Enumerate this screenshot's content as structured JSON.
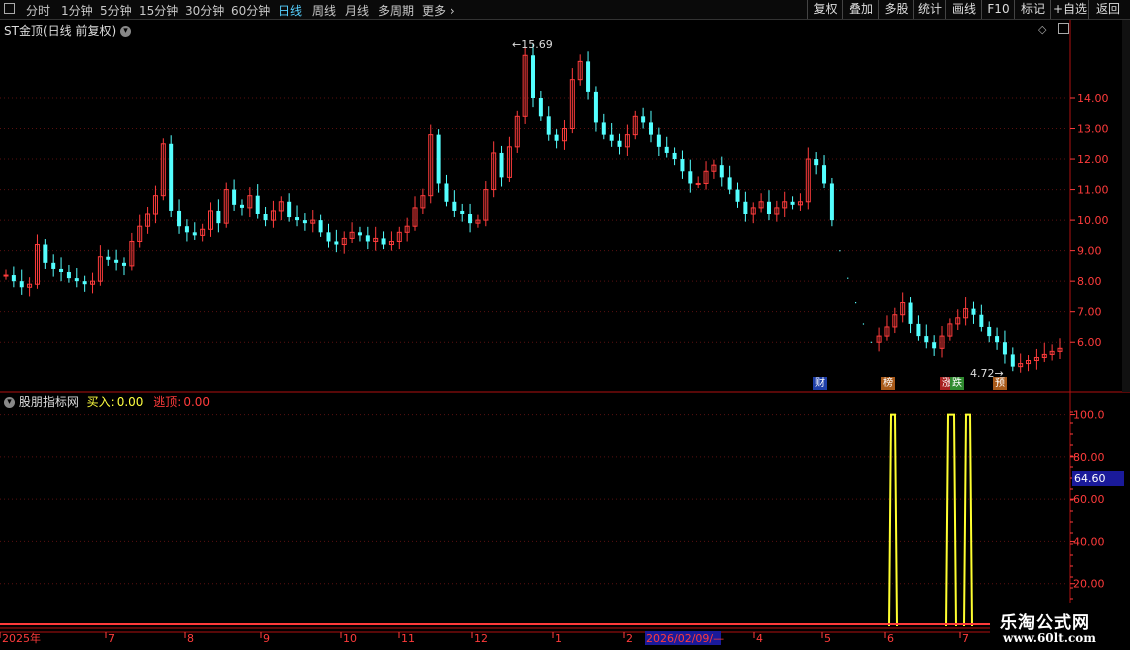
{
  "toolbar": {
    "periods": [
      "分时",
      "1分钟",
      "5分钟",
      "15分钟",
      "30分钟",
      "60分钟",
      "日线",
      "周线",
      "月线",
      "多周期",
      "更多"
    ],
    "active_period": "日线",
    "right_buttons": [
      "复权",
      "叠加",
      "多股",
      "统计",
      "画线",
      "F10",
      "标记",
      "+自选",
      "返回"
    ]
  },
  "main_panel": {
    "title": "ST金顶(日线 前复权)",
    "high_label": "15.69",
    "low_label": "4.72",
    "badges": [
      "财",
      "榜",
      "涨",
      "跌",
      "预"
    ]
  },
  "indicator_panel": {
    "name": "股朋指标网",
    "buy_label": "买入:",
    "buy_value": "0.00",
    "sell_label": "逃顶:",
    "sell_value": "0.00",
    "current_value": "64.60"
  },
  "axes": {
    "price_ticks": [
      "14.00",
      "13.00",
      "12.00",
      "11.00",
      "10.00",
      "9.00",
      "8.00",
      "7.00",
      "6.00"
    ],
    "indicator_ticks": [
      "100.0",
      "80.00",
      "60.00",
      "40.00",
      "20.00"
    ],
    "x_labels": [
      "2025年",
      "7",
      "8",
      "9",
      "10",
      "11",
      "12",
      "1",
      "2",
      "2026/02/09/—",
      "4",
      "5",
      "6",
      "7"
    ]
  },
  "chart_data": {
    "type": "candlestick",
    "price_series_approx": [
      8.2,
      8.0,
      7.8,
      7.9,
      9.2,
      8.6,
      8.4,
      8.3,
      8.1,
      8.0,
      7.9,
      8.0,
      8.8,
      8.7,
      8.6,
      8.5,
      9.3,
      9.8,
      10.2,
      10.8,
      12.5,
      10.3,
      9.8,
      9.6,
      9.5,
      9.7,
      10.3,
      9.9,
      11.0,
      10.5,
      10.4,
      10.8,
      10.2,
      10.0,
      10.3,
      10.6,
      10.1,
      10.0,
      9.9,
      10.0,
      9.6,
      9.3,
      9.2,
      9.4,
      9.6,
      9.5,
      9.3,
      9.4,
      9.2,
      9.3,
      9.6,
      9.8,
      10.4,
      10.8,
      12.8,
      11.2,
      10.6,
      10.3,
      10.2,
      9.9,
      10.0,
      11.0,
      12.2,
      11.4,
      12.4,
      13.4,
      15.4,
      14.0,
      13.4,
      12.8,
      12.6,
      13.0,
      14.6,
      15.2,
      14.2,
      13.2,
      12.8,
      12.6,
      12.4,
      12.8,
      13.4,
      13.2,
      12.8,
      12.4,
      12.2,
      12.0,
      11.6,
      11.2,
      11.2,
      11.6,
      11.8,
      11.4,
      11.0,
      10.6,
      10.2,
      10.4,
      10.6,
      10.2,
      10.4,
      10.6,
      10.5,
      10.6,
      12.0,
      11.8,
      11.2,
      10.0,
      9.0,
      8.1,
      7.3,
      6.6,
      6.0,
      6.2,
      6.5,
      6.9,
      7.3,
      6.6,
      6.2,
      6.0,
      5.8,
      6.2,
      6.6,
      6.8,
      7.1,
      6.9,
      6.5,
      6.2,
      6.0,
      5.6,
      5.2,
      5.3,
      5.4,
      5.5,
      5.6,
      5.7,
      5.8
    ],
    "price_range": [
      4.5,
      15.9
    ],
    "indicator_range": [
      0,
      105
    ],
    "indicator_spikes": [
      {
        "x_label": "6",
        "value": 100
      },
      {
        "x_label": "7",
        "value": 100
      },
      {
        "x_label": "7",
        "value": 100
      }
    ]
  }
}
